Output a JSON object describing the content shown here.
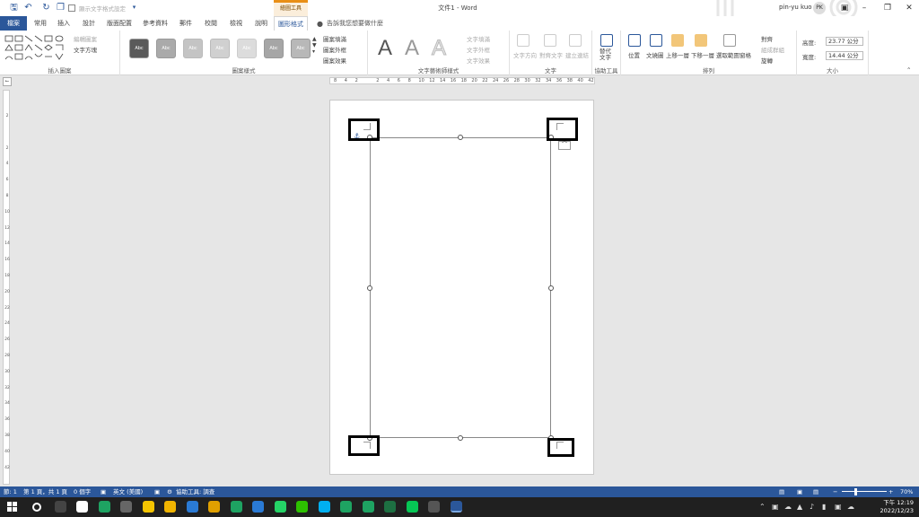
{
  "titlebar": {
    "autosave_label": "顯示文字格式設定",
    "context_group": "繪圖工具",
    "doc_title": "文件1 - Word",
    "user": "pin-yu kuo",
    "initials": "PK"
  },
  "tabs": [
    "常用",
    "插入",
    "設計",
    "版面配置",
    "參考資料",
    "郵件",
    "校閱",
    "檢視",
    "說明",
    "圖形格式"
  ],
  "file_tab": "檔案",
  "active_tab": "圖形格式",
  "tellme": "告訴我您想要做什麼",
  "ribbon": {
    "insert_shapes": {
      "label": "插入圖案",
      "edit_shape": "編輯圖案",
      "text_box": "文字方塊"
    },
    "shape_styles": {
      "label": "圖案樣式",
      "swatch_text": "Abc",
      "fill": "圖案填滿",
      "outline": "圖案外框",
      "effects": "圖案效果"
    },
    "wordart": {
      "label": "文字藝術師樣式",
      "letter": "A",
      "fill": "文字填滿",
      "outline": "文字外框",
      "effects": "文字效果"
    },
    "text": {
      "label": "文字",
      "direction": "文字方向",
      "align": "對齊文字",
      "link": "建立連結"
    },
    "accessibility": {
      "label": "協助工具",
      "alt_text": "替代文字"
    },
    "arrange": {
      "label": "排列",
      "position": "位置",
      "wrap": "文繞圖",
      "forward": "上移一層",
      "backward": "下移一層",
      "selection": "選取範圍窗格",
      "align": "對齊",
      "group": "組成群組",
      "rotate": "旋轉"
    },
    "size": {
      "label": "大小",
      "height_label": "高度:",
      "height": "23.77 公分",
      "width_label": "寬度:",
      "width": "14.44 公分"
    }
  },
  "ruler": {
    "h_ticks": [
      "8",
      "4",
      "2",
      "",
      "2",
      "4",
      "6",
      "8",
      "10",
      "12",
      "14",
      "16",
      "18",
      "20",
      "22",
      "24",
      "26",
      "28",
      "30",
      "32",
      "34",
      "36",
      "38",
      "40",
      "42"
    ],
    "v_ticks": [
      "2",
      "",
      "2",
      "4",
      "6",
      "8",
      "10",
      "12",
      "14",
      "16",
      "18",
      "20",
      "22",
      "24",
      "26",
      "28",
      "30",
      "32",
      "34",
      "36",
      "38",
      "40",
      "42"
    ]
  },
  "statusbar": {
    "section": "節: 1",
    "page": "第 1 頁，共 1 頁",
    "words": "0 個字",
    "language": "英文 (美國)",
    "accessibility": "協助工具: 調查",
    "zoom": "70%"
  },
  "taskbar": {
    "time": "下午 12:19",
    "date": "2022/12/23",
    "apps": [
      "search",
      "task-view",
      "file",
      "chrome",
      "settings",
      "sticky-notes",
      "explorer",
      "store",
      "word-icon",
      "chrome",
      "edge",
      "whatsapp",
      "wechat",
      "skype",
      "chrome",
      "chrome",
      "excel",
      "line",
      "cloud",
      "word"
    ]
  },
  "colors": {
    "accent": "#2b579a",
    "context": "#e98f16"
  }
}
